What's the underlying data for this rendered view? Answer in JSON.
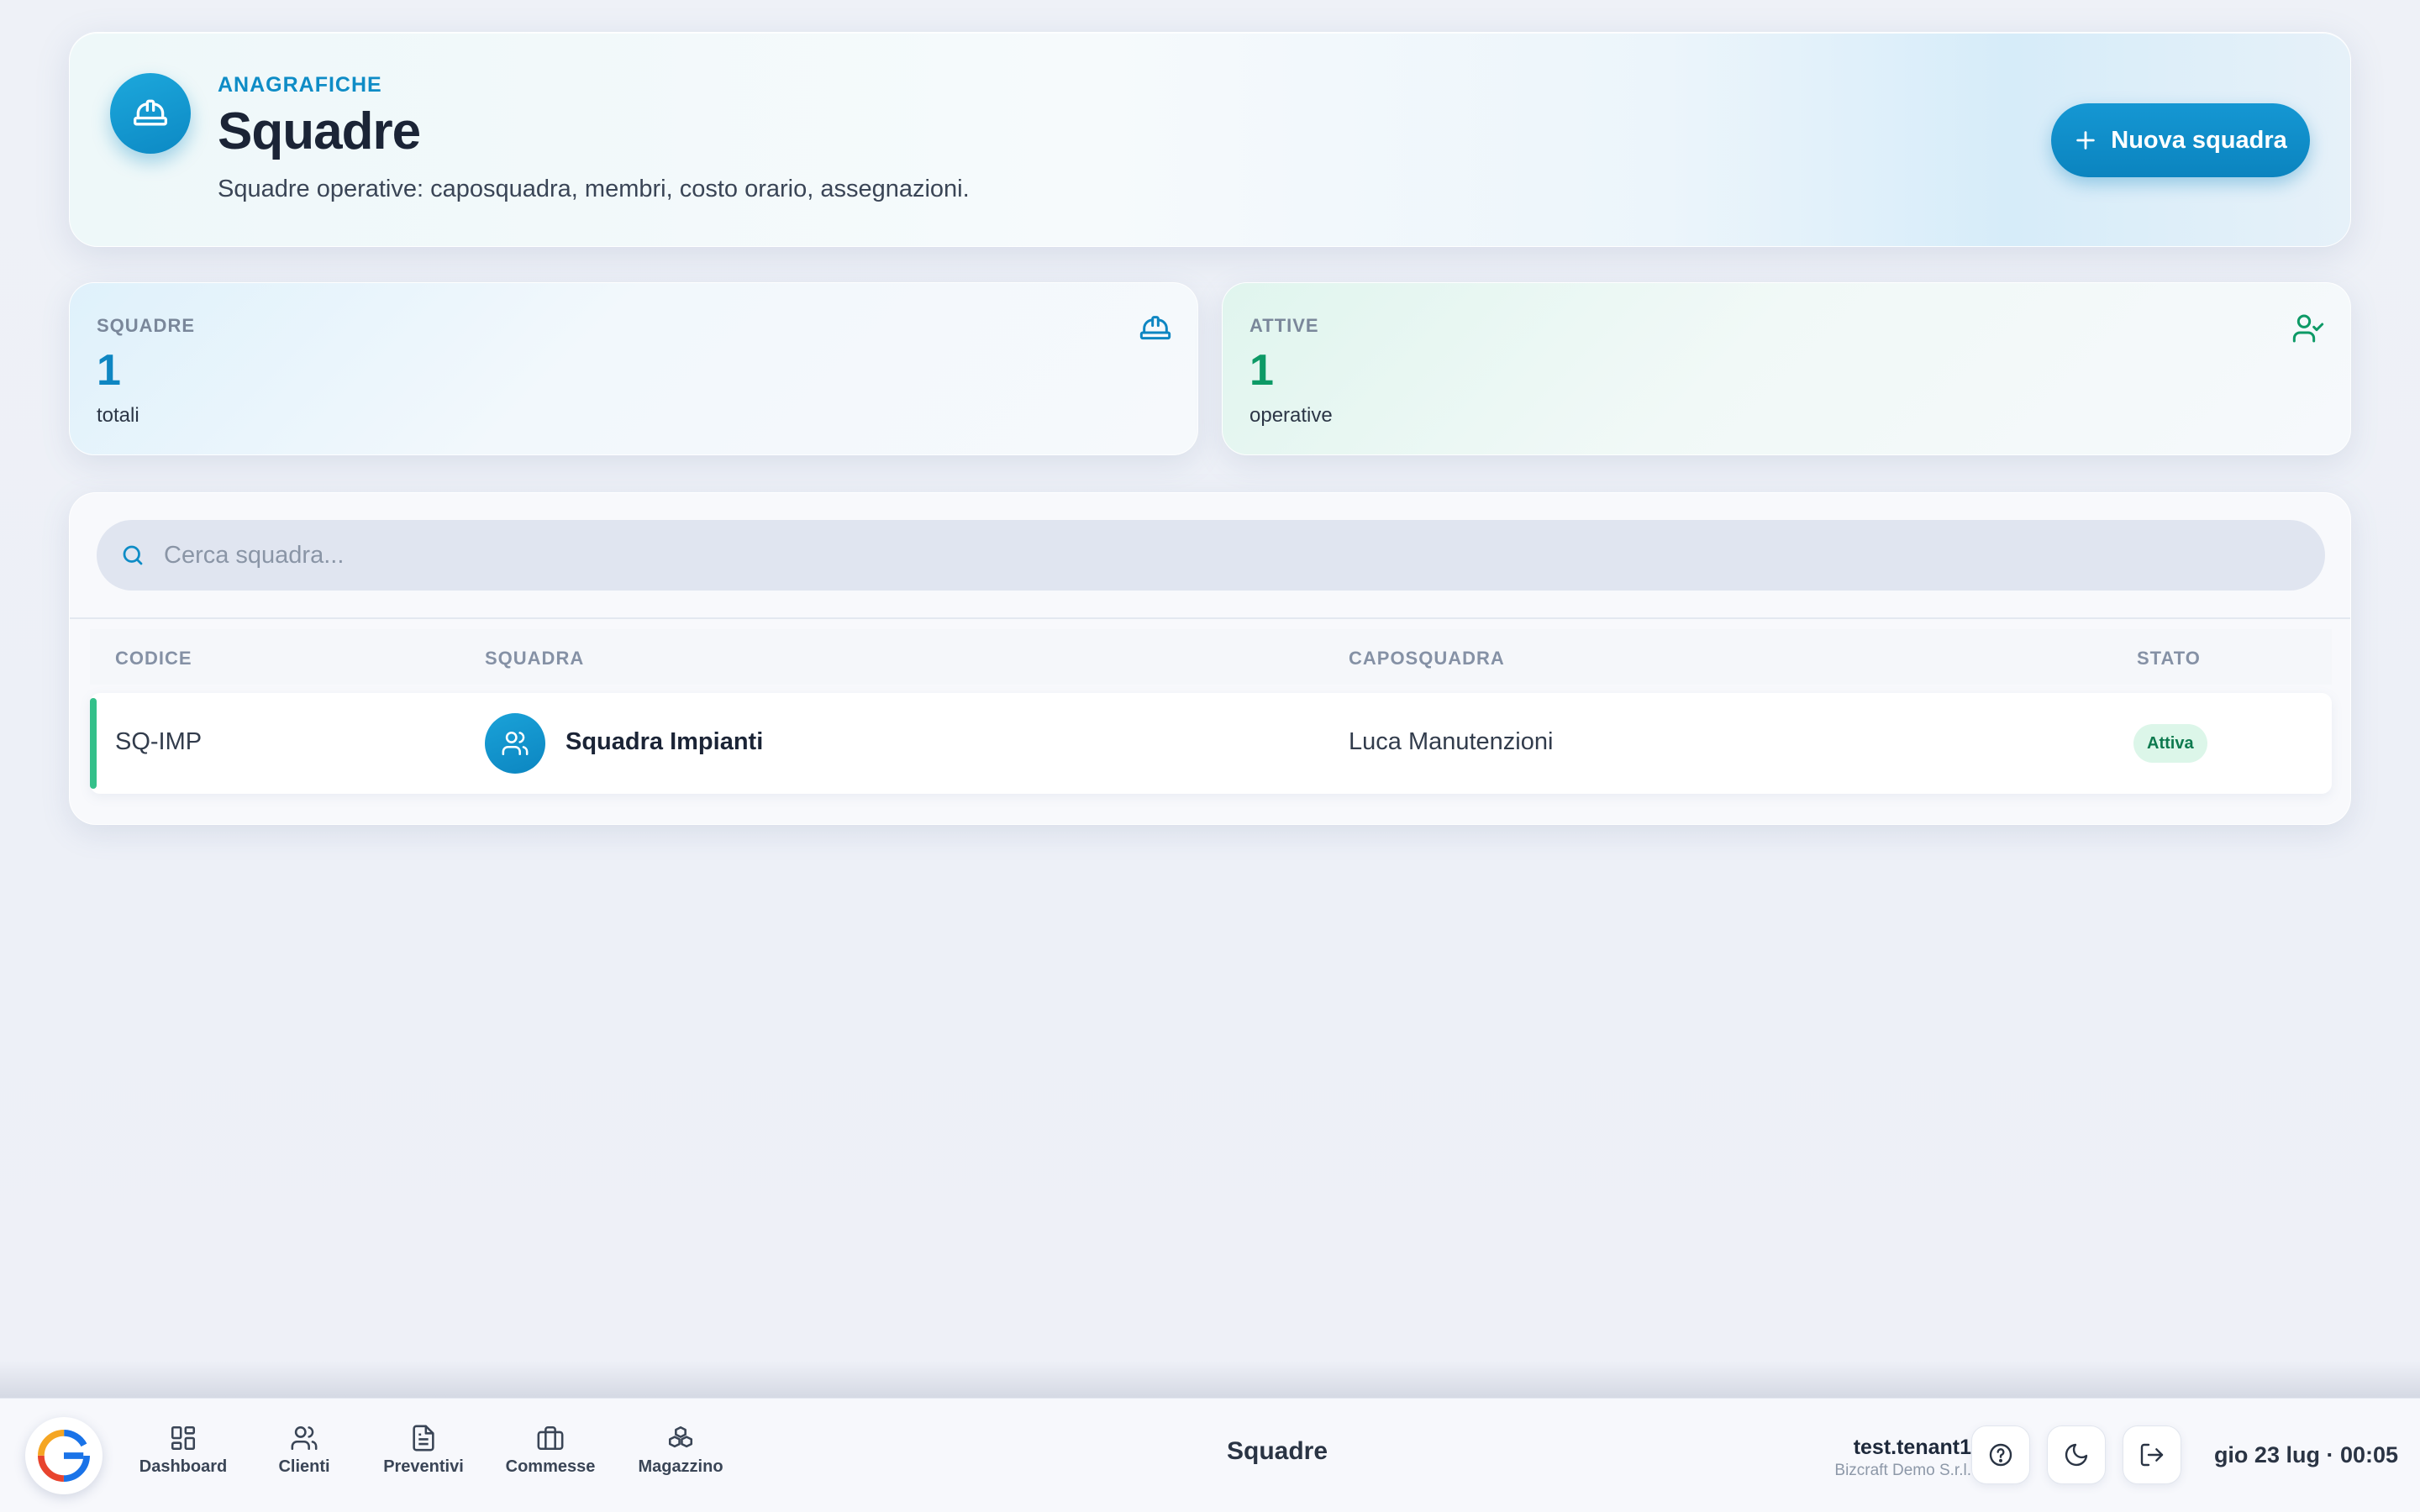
{
  "header": {
    "eyebrow": "ANAGRAFICHE",
    "title": "Squadre",
    "subtitle": "Squadre operative: caposquadra, membri, costo orario, assegnazioni.",
    "new_button": "Nuova squadra",
    "icon": "hardhat-icon"
  },
  "stats": [
    {
      "label": "SQUADRE",
      "value": "1",
      "caption": "totali",
      "icon": "hardhat-icon",
      "color": "#0e86c2"
    },
    {
      "label": "ATTIVE",
      "value": "1",
      "caption": "operative",
      "icon": "user-check-icon",
      "color": "#0d9a66"
    }
  ],
  "search": {
    "placeholder": "Cerca squadra..."
  },
  "table": {
    "columns": [
      "CODICE",
      "SQUADRA",
      "CAPOSQUADRA",
      "STATO"
    ],
    "rows": [
      {
        "code": "SQ-IMP",
        "name": "Squadra Impianti",
        "leader": "Luca Manutenzioni",
        "status": "Attiva",
        "status_color": "#34c08a"
      }
    ]
  },
  "dock": {
    "nav": [
      {
        "label": "Dashboard",
        "icon": "dashboard-icon"
      },
      {
        "label": "Clienti",
        "icon": "users-icon"
      },
      {
        "label": "Preventivi",
        "icon": "document-icon"
      },
      {
        "label": "Commesse",
        "icon": "briefcase-icon"
      },
      {
        "label": "Magazzino",
        "icon": "boxes-icon"
      }
    ],
    "page_title": "Squadre",
    "user": {
      "name": "test.tenant1",
      "company": "Bizcraft Demo S.r.l."
    },
    "clock": "gio 23 lug · 00:05"
  },
  "colors": {
    "accent": "#0e8cc6",
    "success": "#34c08a",
    "background": "#eef1f7"
  }
}
